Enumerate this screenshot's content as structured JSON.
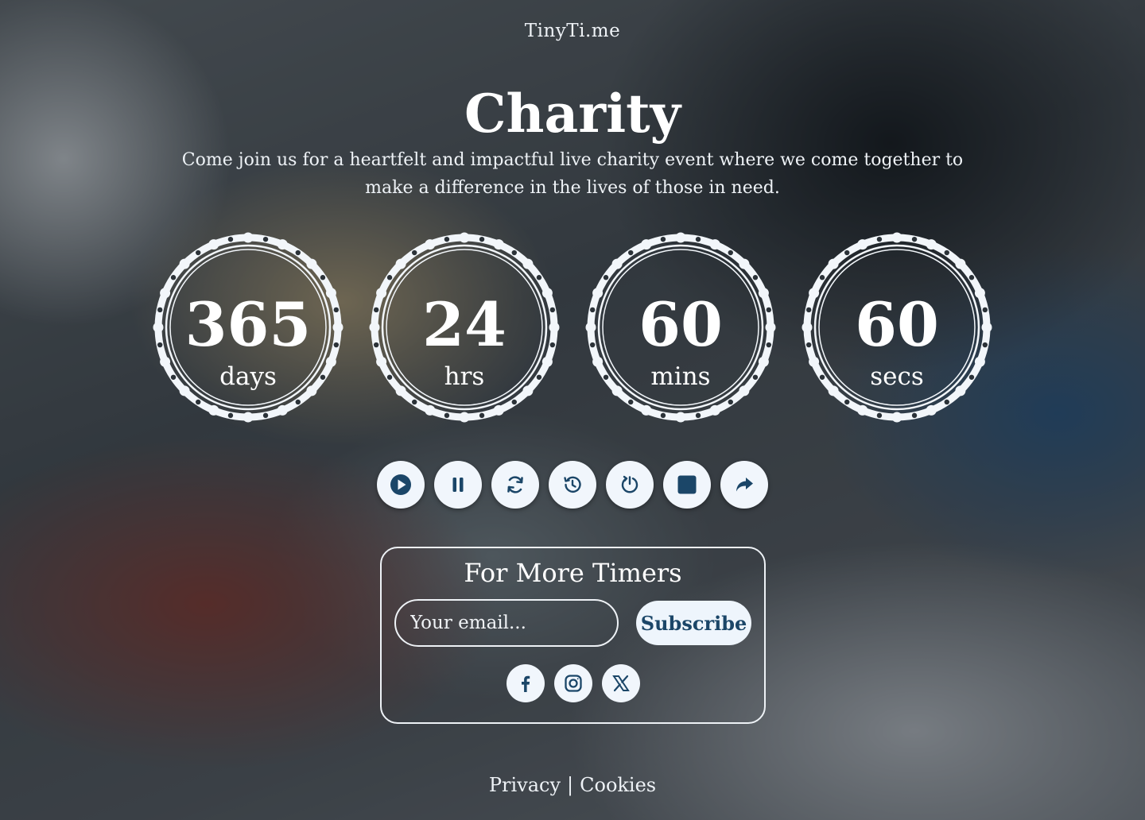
{
  "brand": "TinyTi.me",
  "title": "Charity",
  "description": "Come join us for a heartfelt and impactful live charity event where we come together to make a difference in the lives of those in need.",
  "timers": [
    {
      "value": "365",
      "unit": "days"
    },
    {
      "value": "24",
      "unit": "hrs"
    },
    {
      "value": "60",
      "unit": "mins"
    },
    {
      "value": "60",
      "unit": "secs"
    }
  ],
  "controls": [
    {
      "name": "play-icon"
    },
    {
      "name": "pause-icon"
    },
    {
      "name": "refresh-icon"
    },
    {
      "name": "history-icon"
    },
    {
      "name": "restart-icon"
    },
    {
      "name": "stop-icon"
    },
    {
      "name": "share-icon"
    }
  ],
  "subscribe": {
    "title": "For More Timers",
    "email_placeholder": "Your email...",
    "button_label": "Subscribe"
  },
  "social": [
    "facebook-icon",
    "instagram-icon",
    "x-icon"
  ],
  "footer": {
    "privacy": "Privacy",
    "separator": "|",
    "cookies": "Cookies"
  },
  "colors": {
    "accent": "#1b4668",
    "button_bg": "#f1f6fc",
    "text": "#ffffff"
  }
}
